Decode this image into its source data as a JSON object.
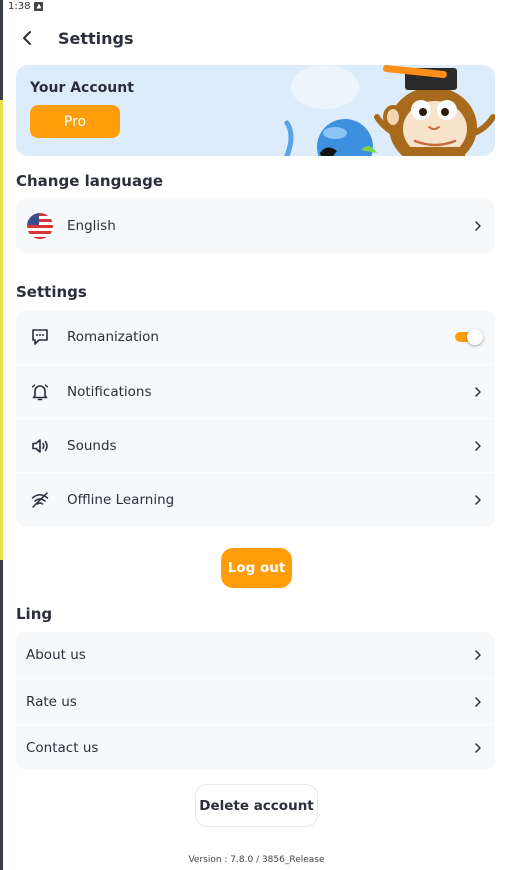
{
  "status_bar": {
    "time": "1:38"
  },
  "header": {
    "title": "Settings"
  },
  "account_banner": {
    "title": "Your Account",
    "pro_label": "Pro"
  },
  "language_section": {
    "title": "Change language",
    "current": "English"
  },
  "settings_section": {
    "title": "Settings",
    "items": [
      {
        "label": "Romanization",
        "icon": "chat-bubble-icon",
        "control": "toggle",
        "enabled": true
      },
      {
        "label": "Notifications",
        "icon": "bell-icon",
        "control": "chevron"
      },
      {
        "label": "Sounds",
        "icon": "speaker-icon",
        "control": "chevron"
      },
      {
        "label": "Offline Learning",
        "icon": "wifi-off-icon",
        "control": "chevron"
      }
    ]
  },
  "logout_label": "Log out",
  "ling_section": {
    "title": "Ling",
    "items": [
      {
        "label": "About us"
      },
      {
        "label": "Rate us"
      },
      {
        "label": "Contact us"
      }
    ]
  },
  "delete_account_label": "Delete account",
  "version_text": "Version : 7.8.0 / 3856_Release",
  "colors": {
    "accent": "#ff9d0a",
    "banner_bg": "#dcecfb",
    "card_bg": "#f7f8fa",
    "text": "#2b2f3a"
  }
}
